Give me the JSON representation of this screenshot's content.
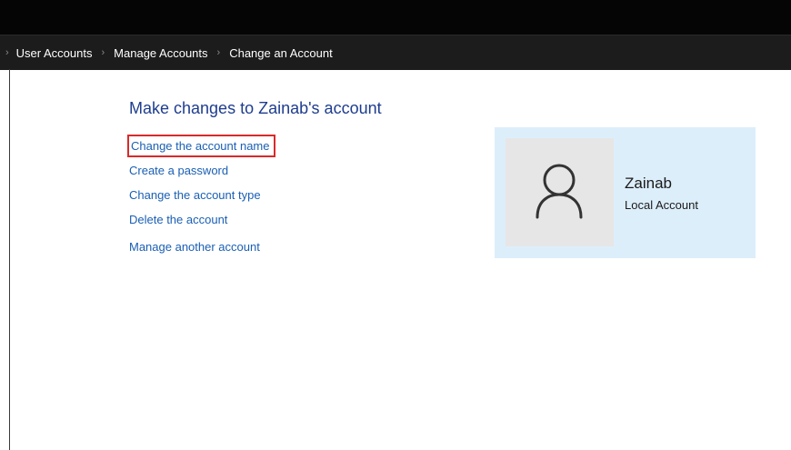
{
  "breadcrumb": {
    "items": [
      "User Accounts",
      "Manage Accounts",
      "Change an Account"
    ]
  },
  "main": {
    "heading": "Make changes to Zainab's account",
    "links": [
      "Change the account name",
      "Create a password",
      "Change the account type",
      "Delete the account"
    ],
    "secondary_link": "Manage another account"
  },
  "user_card": {
    "name": "Zainab",
    "account_type": "Local Account",
    "icon": "user-avatar-icon"
  },
  "colors": {
    "titlebar": "#050505",
    "breadcrumb_bar": "#1c1c1c",
    "heading": "#1e3d8f",
    "link": "#1a5fb4",
    "highlight_border": "#d72b2b",
    "card_background": "#ddeefb",
    "avatar_background": "#e6e6e6"
  }
}
